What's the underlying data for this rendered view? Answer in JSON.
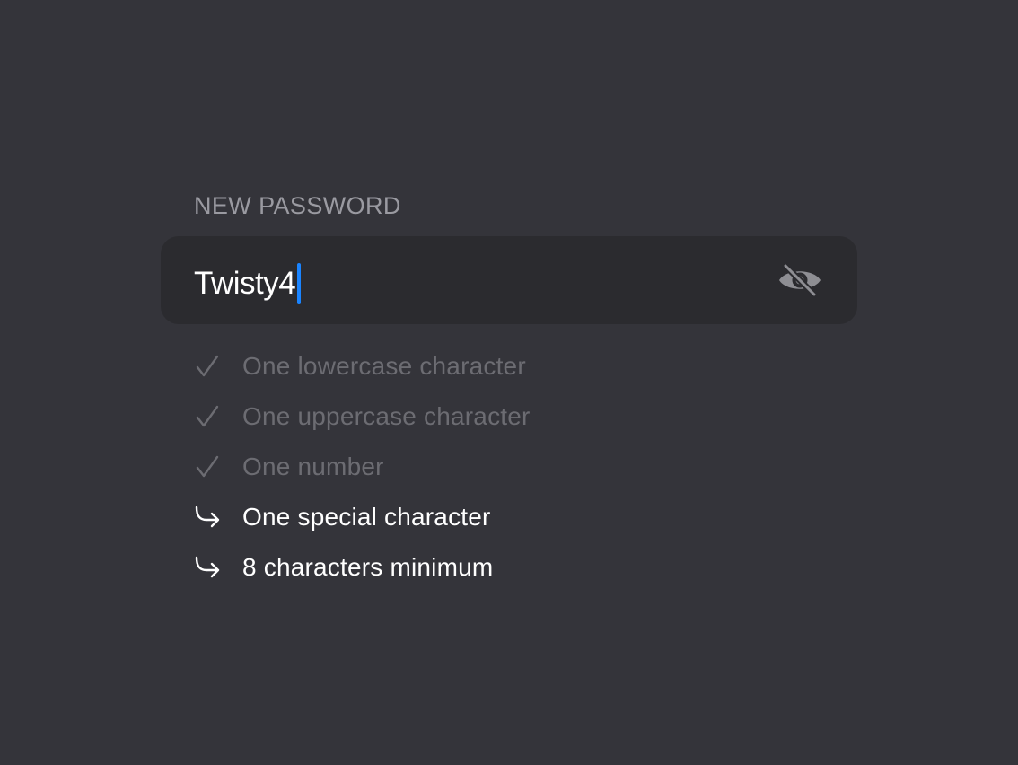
{
  "form": {
    "label": "NEW PASSWORD",
    "password": {
      "value": "Twisty4",
      "visibility_icon": "eye-slash-icon",
      "caret_color": "#1a84ff"
    },
    "requirements": [
      {
        "text": "One lowercase character",
        "status": "met",
        "icon": "checkmark-icon"
      },
      {
        "text": "One uppercase character",
        "status": "met",
        "icon": "checkmark-icon"
      },
      {
        "text": "One number",
        "status": "met",
        "icon": "checkmark-icon"
      },
      {
        "text": "One special character",
        "status": "unmet",
        "icon": "arrow-turn-right-icon"
      },
      {
        "text": "8 characters minimum",
        "status": "unmet",
        "icon": "arrow-turn-right-icon"
      }
    ]
  },
  "colors": {
    "background": "#34343a",
    "input_background": "#2b2b2f",
    "label": "#9a9aa1",
    "met_text": "#6c6c72",
    "unmet_text": "#ffffff",
    "accent": "#1a84ff"
  }
}
